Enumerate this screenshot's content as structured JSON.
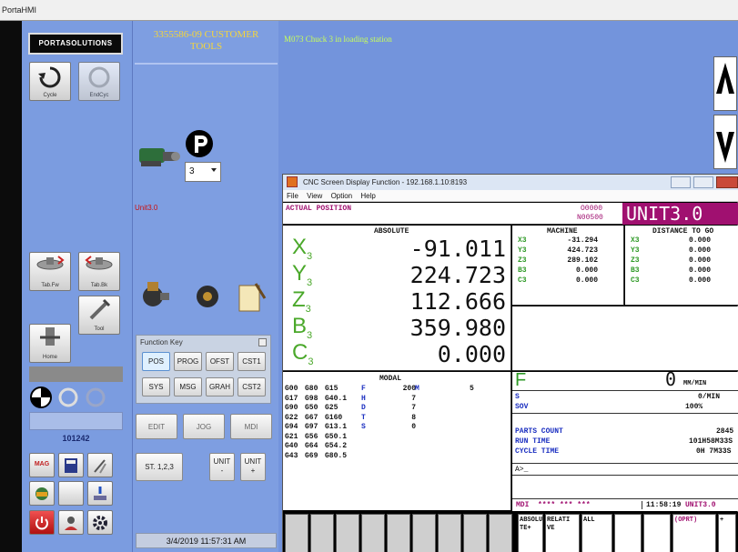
{
  "window_title": "PortaHMI",
  "brand": "PORTASOLUTIONS",
  "left_icons": {
    "cycle": "Cycle",
    "endcyc": "EndCyc",
    "tab_fw": "Tab.Fw",
    "tab_bk": "Tab.Bk",
    "tool": "Tool",
    "home": "Home"
  },
  "counter": "101242",
  "mag_label": "MAG",
  "job_title": "3355586-09 CUSTOMER TOOLS",
  "unit_status": "Unit3.0",
  "program_select": "3",
  "function_key": {
    "title": "Function Key",
    "row1": [
      "POS",
      "PROG",
      "OFST",
      "CST1"
    ],
    "row2": [
      "SYS",
      "MSG",
      "GRAH",
      "CST2"
    ]
  },
  "mode_buttons": [
    "EDIT",
    "JOG",
    "MDI"
  ],
  "st_button": "ST. 1,2,3",
  "unit_minus": [
    "UNIT",
    "-"
  ],
  "unit_plus": [
    "UNIT",
    "+"
  ],
  "datetime": "3/4/2019 11:57:31 AM",
  "message": "M073  Chuck 3 in loading station",
  "cnc": {
    "title": "CNC Screen Display Function - 192.168.1.10:8193",
    "menu": [
      "File",
      "View",
      "Option",
      "Help"
    ],
    "actual_position": "ACTUAL POSITION",
    "prog_o": "O0000",
    "prog_n": "N00500",
    "unit": "UNIT3.0",
    "absolute_title": "ABSOLUTE",
    "absolute": [
      {
        "axis": "X",
        "sub": "3",
        "value": "-91.011"
      },
      {
        "axis": "Y",
        "sub": "3",
        "value": "224.723"
      },
      {
        "axis": "Z",
        "sub": "3",
        "value": "112.666"
      },
      {
        "axis": "B",
        "sub": "3",
        "value": "359.980"
      },
      {
        "axis": "C",
        "sub": "3",
        "value": "0.000"
      }
    ],
    "machine_title": "MACHINE",
    "machine": [
      {
        "axis": "X3",
        "value": "-31.294"
      },
      {
        "axis": "Y3",
        "value": "424.723"
      },
      {
        "axis": "Z3",
        "value": "289.102"
      },
      {
        "axis": "B3",
        "value": "0.000"
      },
      {
        "axis": "C3",
        "value": "0.000"
      }
    ],
    "dtg_title": "DISTANCE TO GO",
    "dtg": [
      {
        "axis": "X3",
        "value": "0.000"
      },
      {
        "axis": "Y3",
        "value": "0.000"
      },
      {
        "axis": "Z3",
        "value": "0.000"
      },
      {
        "axis": "B3",
        "value": "0.000"
      },
      {
        "axis": "C3",
        "value": "0.000"
      }
    ],
    "modal_title": "MODAL",
    "modal_rows": [
      [
        "G00",
        "G80",
        "G15",
        "F",
        "200",
        "M",
        "5"
      ],
      [
        "G17",
        "G98",
        "G40.1",
        "H",
        "7",
        "",
        ""
      ],
      [
        "G90",
        "G50",
        "G25",
        "D",
        "7",
        "",
        ""
      ],
      [
        "G22",
        "G67",
        "G160",
        "T",
        "8",
        "",
        ""
      ],
      [
        "G94",
        "G97",
        "G13.1",
        "S",
        "0",
        "",
        ""
      ],
      [
        "G21",
        "G56",
        "G50.1",
        "",
        "",
        "",
        ""
      ],
      [
        "G40",
        "G64",
        "G54.2",
        "",
        "",
        "",
        ""
      ],
      [
        "G43",
        "G69",
        "G80.5",
        "",
        "",
        "",
        ""
      ]
    ],
    "feed_label": "F",
    "feed_value": "0",
    "feed_unit": "MM/MIN",
    "s_label": "S",
    "s_value": "0/MIN",
    "sov_label": "SOV",
    "sov_value": "100%",
    "parts_count_label": "PARTS COUNT",
    "parts_count": "2845",
    "run_time_label": "RUN TIME",
    "run_time": "101H58M33S",
    "cycle_time_label": "CYCLE TIME",
    "cycle_time": "0H 7M33S",
    "prompt": "A>_",
    "mode_line": "MDI  **** *** ***",
    "clock": "11:58:19",
    "unit_small": "UNIT3.0",
    "softkeys": [
      "ABSOLU TE+",
      "RELATI VE",
      "ALL",
      "",
      "",
      "(OPRT)",
      "+"
    ]
  },
  "colors": {
    "panel_blue": "#7b9ce0",
    "job_title": "#f4d53c",
    "message": "#c8ff5a",
    "unit_magenta": "#a01070",
    "status_red": "#cc1010"
  }
}
